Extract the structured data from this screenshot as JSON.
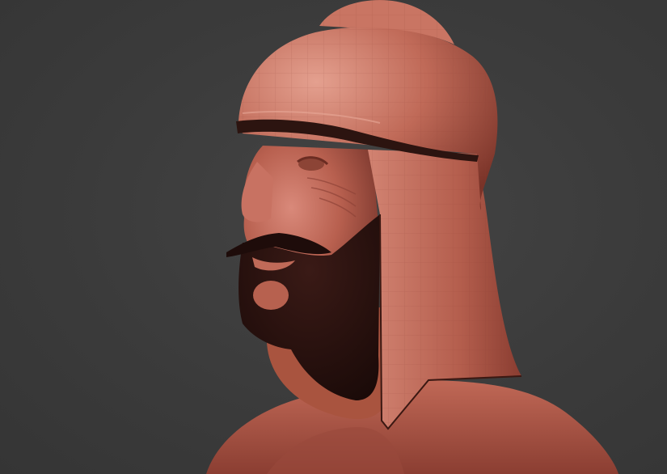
{
  "scene": {
    "background_color": "#3b3b3b",
    "material_color": "#b05a4c",
    "hair_color": "#2a1210",
    "subject": "sculpted-warrior-bust"
  }
}
